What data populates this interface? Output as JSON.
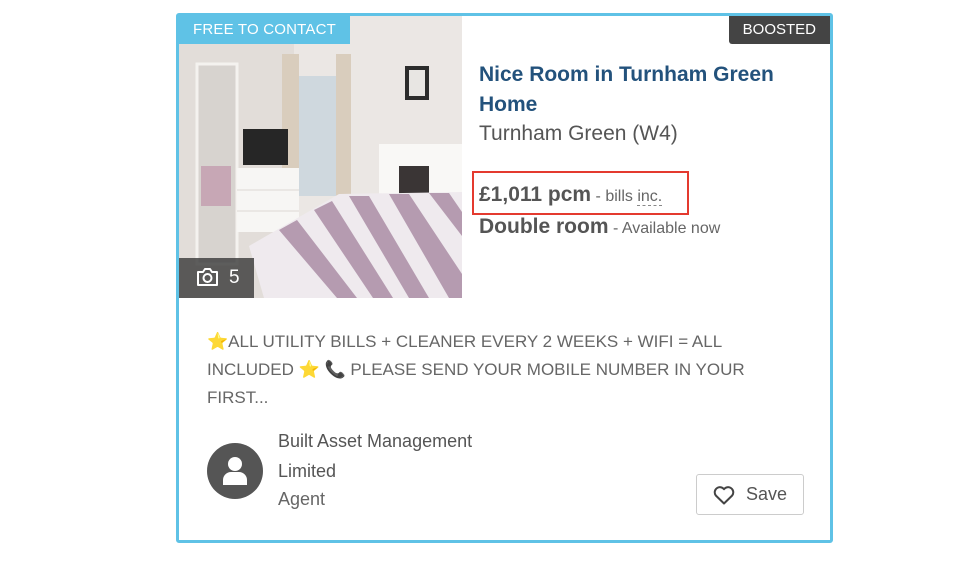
{
  "listing": {
    "badge_free": "FREE TO CONTACT",
    "badge_boosted": "BOOSTED",
    "photo_count": "5",
    "title": "Nice Room in Turnham Green Home",
    "area": "Turnham Green (W4)",
    "price": "£1,011 pcm",
    "price_sep": " - bills ",
    "bills_inc": "inc.",
    "room_type": "Double room",
    "availability": " - Available now",
    "description_part1": "ALL UTILITY BILLS + CLEANER EVERY 2 WEEKS + WIFI = ALL INCLUDED ",
    "description_part2": " PLEASE SEND YOUR MOBILE NUMBER IN YOUR FIRST...",
    "advertiser_name": "Built Asset Management Limited",
    "advertiser_role": "Agent",
    "save_label": "Save"
  },
  "icons": [
    "camera-icon",
    "star-icon",
    "phone-icon",
    "user-icon",
    "heart-icon"
  ],
  "colors": {
    "accent": "#5fc2e6",
    "title": "#23527c",
    "boosted_bg": "#444444",
    "highlight_box": "#e43a2f"
  }
}
